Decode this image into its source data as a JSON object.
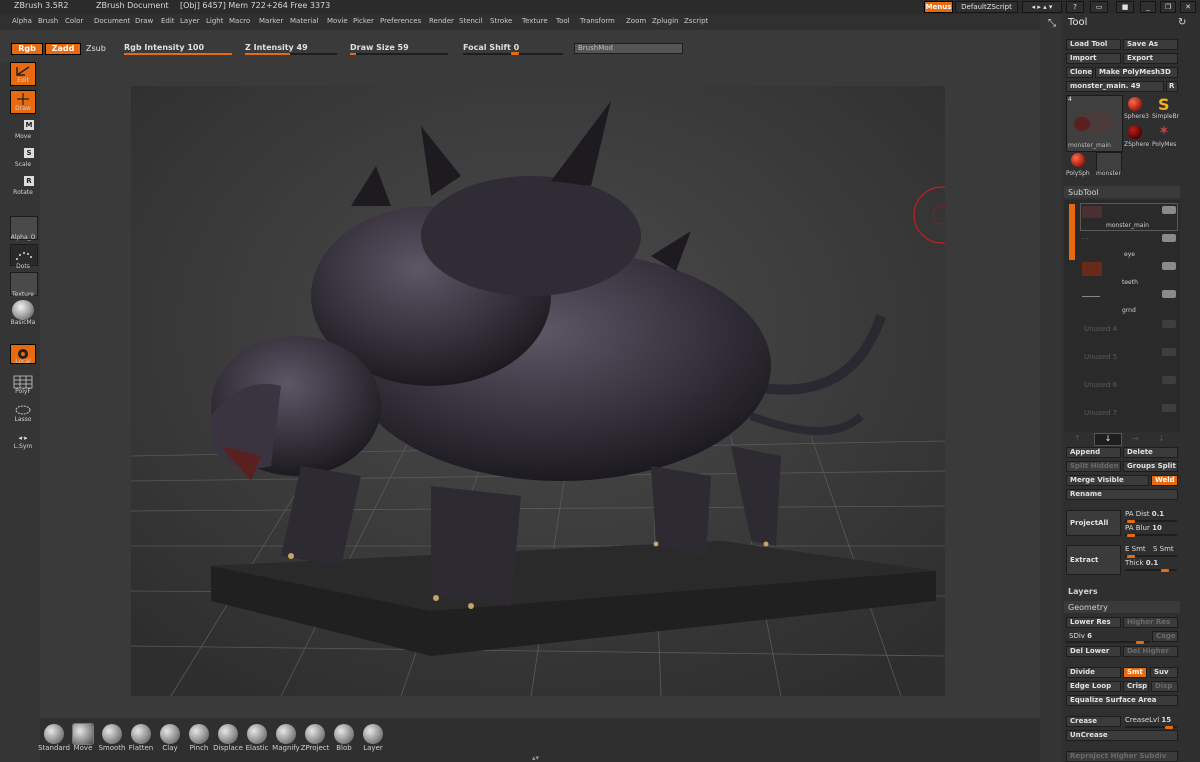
{
  "title_bar": {
    "app": "ZBrush 3.5R2",
    "document": "ZBrush Document",
    "stats": "[Obj] 6457] Mem 722+264 Free 3373",
    "menus_button": "Menus",
    "zscript_button": "DefaultZScript"
  },
  "menu": [
    "Alpha",
    "Brush",
    "Color",
    "Document",
    "Draw",
    "Edit",
    "Layer",
    "Light",
    "Macro",
    "Marker",
    "Material",
    "Movie",
    "Picker",
    "Preferences",
    "Render",
    "Stencil",
    "Stroke",
    "Texture",
    "Tool",
    "Transform",
    "Zoom",
    "Zplugin",
    "Zscript"
  ],
  "shelf": {
    "rgb": "Rgb",
    "zadd": "Zadd",
    "zsub": "Zsub",
    "rgb_intensity": {
      "label": "Rgb Intensity",
      "value": "100",
      "fraction": 1.0
    },
    "z_intensity": {
      "label": "Z Intensity",
      "value": "49",
      "fraction": 0.49
    },
    "draw_size": {
      "label": "Draw Size",
      "value": "59",
      "fraction": 0.06
    },
    "focal_shift": {
      "label": "Focal Shift",
      "value": "0",
      "fraction": 0.5
    },
    "brush_mod": "BrushMod"
  },
  "left_tools": {
    "edit": "Edit",
    "draw": "Draw",
    "move": "Move",
    "scale": "Scale",
    "rotate": "Rotate",
    "alpha": "Alpha_O",
    "dots": "Dots",
    "texture": "Texture",
    "material": "BasicMa",
    "local": "Local",
    "polyf": "PolyF",
    "lasso": "Lasso",
    "lsym": "L.Sym"
  },
  "brushes": [
    "Standard",
    "Move",
    "Smooth",
    "Flatten",
    "Clay",
    "Pinch",
    "Displace",
    "Elastic",
    "Magnify",
    "ZProject",
    "Blob",
    "Layer"
  ],
  "tool_panel": {
    "title": "Tool",
    "load_tool": "Load Tool",
    "save_as": "Save As",
    "import": "Import",
    "export": "Export",
    "clone": "Clone",
    "make_polymesh": "Make PolyMesh3D",
    "current_tool": "monster_main. 49",
    "r_button": "R",
    "thumb_count": "4",
    "thumb_main_label": "monster_main",
    "thumbs": [
      "Sphere3",
      "SimpleBr",
      "ZSphere",
      "PolyMes",
      "PolySph",
      "monster"
    ],
    "subtool_header": "SubTool",
    "subtools": [
      "monster_main",
      "eye",
      "teeth",
      "grnd"
    ],
    "unused": [
      "Unused 4",
      "Unused 5",
      "Unused 6",
      "Unused 7"
    ],
    "append": "Append",
    "delete": "Delete",
    "split_hidden": "Split Hidden",
    "groups_split": "Groups Split",
    "merge_visible": "Merge Visible",
    "weld": "Weld",
    "rename": "Rename",
    "project_all": "ProjectAll",
    "pa_dist": "PA Dist",
    "pa_dist_value": "0.1",
    "pa_blur": "PA Blur",
    "pa_blur_value": "10",
    "extract": "Extract",
    "e_smt": "E Smt",
    "s_smt": "S Smt",
    "thick": "Thick",
    "thick_value": "0.1",
    "layers": "Layers",
    "geometry": "Geometry",
    "lower_res": "Lower Res",
    "higher_res": "Higher Res",
    "sdiv": "SDiv",
    "sdiv_value": "6",
    "cage": "Cage",
    "del_lower": "Del Lower",
    "del_higher": "Del Higher",
    "divide": "Divide",
    "smt": "Smt",
    "suv": "Suv",
    "edge_loop": "Edge Loop",
    "crisp": "Crisp",
    "disp": "Disp",
    "equalize": "Equalize Surface Area",
    "crease": "Crease",
    "crease_lvl": "CreaseLvl",
    "crease_lvl_value": "15",
    "uncrease": "UnCrease",
    "reproject": "Reproject Higher Subdiv"
  },
  "colors": {
    "accent": "#e86a10",
    "panel": "#2f2f2f",
    "viewport": "#363636"
  }
}
